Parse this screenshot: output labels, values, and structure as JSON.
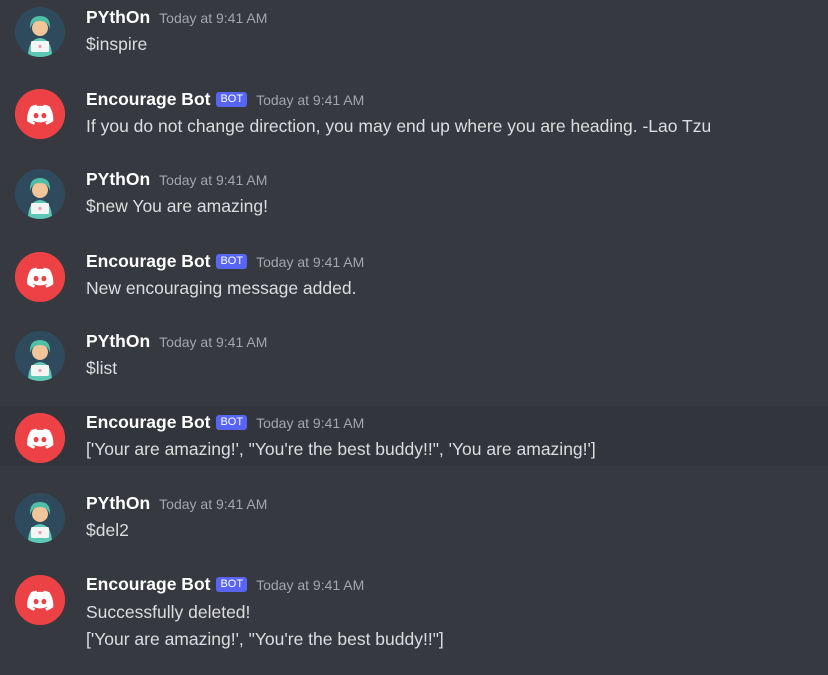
{
  "messages": [
    {
      "author": "PYthOn",
      "badge": "",
      "timestamp": "Today at 9:41 AM",
      "avatar": "user-avatar",
      "lines": [
        "$inspire"
      ]
    },
    {
      "author": "Encourage Bot",
      "badge": "BOT",
      "timestamp": "Today at 9:41 AM",
      "avatar": "discord-bot-avatar",
      "lines": [
        "If you do not change direction, you may end up where you are heading. -Lao Tzu"
      ]
    },
    {
      "author": "PYthOn",
      "badge": "",
      "timestamp": "Today at 9:41 AM",
      "avatar": "user-avatar",
      "lines": [
        "$new You are amazing!"
      ]
    },
    {
      "author": "Encourage Bot",
      "badge": "BOT",
      "timestamp": "Today at 9:41 AM",
      "avatar": "discord-bot-avatar",
      "lines": [
        "New encouraging message added."
      ]
    },
    {
      "author": "PYthOn",
      "badge": "",
      "timestamp": "Today at 9:41 AM",
      "avatar": "user-avatar",
      "lines": [
        "$list"
      ]
    },
    {
      "author": "Encourage Bot",
      "badge": "BOT",
      "timestamp": "Today at 9:41 AM",
      "avatar": "discord-bot-avatar",
      "lines": [
        "['Your are amazing!', \"You're the best buddy!!\", 'You are amazing!']"
      ]
    },
    {
      "author": "PYthOn",
      "badge": "",
      "timestamp": "Today at 9:41 AM",
      "avatar": "user-avatar",
      "lines": [
        "$del2"
      ]
    },
    {
      "author": "Encourage Bot",
      "badge": "BOT",
      "timestamp": "Today at 9:41 AM",
      "avatar": "discord-bot-avatar",
      "lines": [
        "Successfully deleted!",
        "['Your are amazing!', \"You're the best buddy!!\"]"
      ]
    }
  ],
  "colors": {
    "background": "#36393f",
    "hover_background": "#32353b",
    "bot_badge": "#5865f2",
    "bot_avatar": "#ed4245",
    "user_avatar": "#2e4a5c"
  }
}
